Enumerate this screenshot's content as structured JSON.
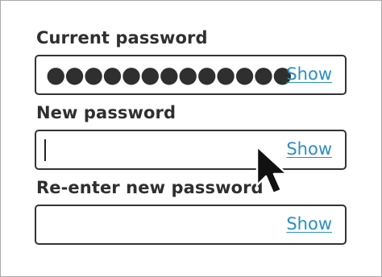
{
  "form": {
    "fields": [
      {
        "label": "Current password",
        "masked_value": "●●●●●●●●●●●●●",
        "show_label": "Show"
      },
      {
        "label": "New password",
        "masked_value": "",
        "show_label": "Show"
      },
      {
        "label": "Re-enter new password",
        "masked_value": "",
        "show_label": "Show"
      }
    ]
  },
  "colors": {
    "link": "#2b8fc4",
    "text": "#2f2f2f",
    "border": "#333333"
  },
  "icons": {
    "pointer": "mouse-pointer-icon"
  }
}
